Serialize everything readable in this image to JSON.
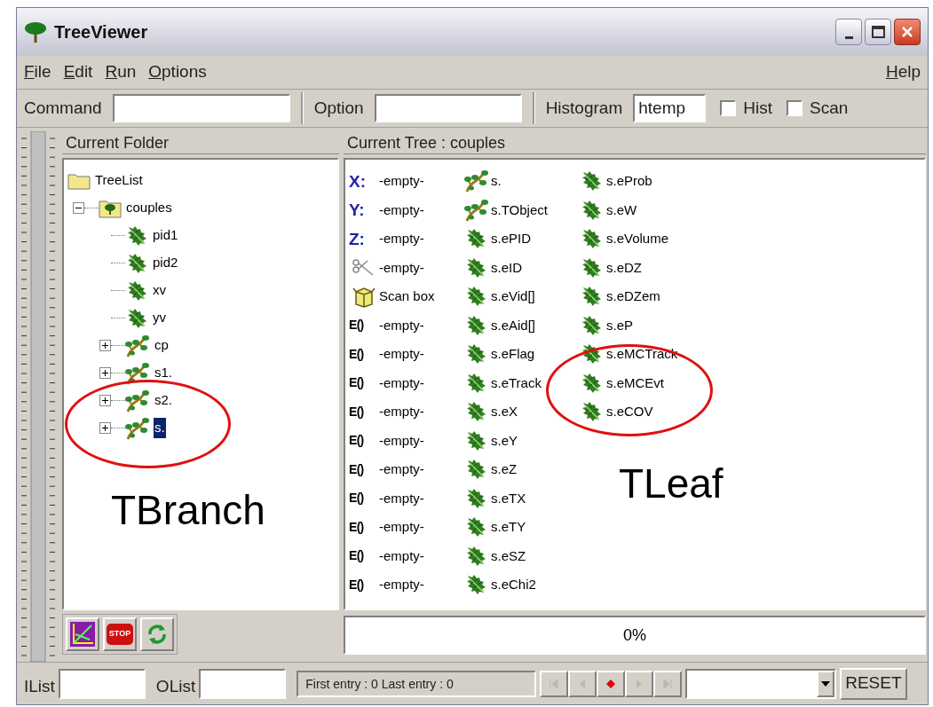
{
  "window": {
    "title": "TreeViewer"
  },
  "menu": {
    "left": [
      "File",
      "Edit",
      "Run",
      "Options"
    ],
    "right": [
      "Help"
    ]
  },
  "toolbar": {
    "command_label": "Command",
    "option_label": "Option",
    "histogram_label": "Histogram",
    "histogram_value": "htemp",
    "checkboxes": [
      {
        "label": "Hist",
        "checked": false
      },
      {
        "label": "Scan",
        "checked": false
      }
    ]
  },
  "folder": {
    "title": "Current Folder",
    "tree": [
      {
        "label": "TreeList",
        "kind": "folder",
        "selected": false,
        "children": [
          {
            "label": "couples",
            "kind": "tree",
            "expanded": true,
            "selected": false,
            "children": [
              {
                "label": "pid1",
                "kind": "leaf",
                "selected": false
              },
              {
                "label": "pid2",
                "kind": "leaf",
                "selected": false
              },
              {
                "label": "xv",
                "kind": "leaf",
                "selected": false
              },
              {
                "label": "yv",
                "kind": "leaf",
                "selected": false
              },
              {
                "label": "cp",
                "kind": "branch",
                "expanded": false,
                "selected": false
              },
              {
                "label": "s1.",
                "kind": "branch",
                "expanded": false,
                "selected": false
              },
              {
                "label": "s2.",
                "kind": "branch",
                "expanded": false,
                "selected": false
              },
              {
                "label": "s.",
                "kind": "branch",
                "expanded": false,
                "selected": true
              }
            ]
          }
        ]
      }
    ],
    "buttons": [
      {
        "kind": "draw"
      },
      {
        "kind": "stop",
        "label": "STOP"
      },
      {
        "kind": "refresh"
      }
    ]
  },
  "current_tree": {
    "title": "Current Tree : couples",
    "columns": [
      [
        {
          "kind": "axis",
          "prefix": "X:",
          "label": "-empty-"
        },
        {
          "kind": "axis",
          "prefix": "Y:",
          "label": "-empty-"
        },
        {
          "kind": "axis",
          "prefix": "Z:",
          "label": "-empty-"
        },
        {
          "kind": "cut",
          "label": "-empty-"
        },
        {
          "kind": "scan",
          "label": "Scan box"
        },
        {
          "kind": "expr",
          "prefix": "E()",
          "label": "-empty-"
        },
        {
          "kind": "expr",
          "prefix": "E()",
          "label": "-empty-"
        },
        {
          "kind": "expr",
          "prefix": "E()",
          "label": "-empty-"
        },
        {
          "kind": "expr",
          "prefix": "E()",
          "label": "-empty-"
        },
        {
          "kind": "expr",
          "prefix": "E()",
          "label": "-empty-"
        },
        {
          "kind": "expr",
          "prefix": "E()",
          "label": "-empty-"
        },
        {
          "kind": "expr",
          "prefix": "E()",
          "label": "-empty-"
        },
        {
          "kind": "expr",
          "prefix": "E()",
          "label": "-empty-"
        },
        {
          "kind": "expr",
          "prefix": "E()",
          "label": "-empty-"
        },
        {
          "kind": "expr",
          "prefix": "E()",
          "label": "-empty-"
        }
      ],
      [
        {
          "kind": "branch",
          "label": "s."
        },
        {
          "kind": "branch",
          "label": "s.TObject"
        },
        {
          "kind": "leaf",
          "label": "s.ePID"
        },
        {
          "kind": "leaf",
          "label": "s.eID"
        },
        {
          "kind": "leaf",
          "label": "s.eVid[]"
        },
        {
          "kind": "leaf",
          "label": "s.eAid[]"
        },
        {
          "kind": "leaf",
          "label": "s.eFlag"
        },
        {
          "kind": "leaf",
          "label": "s.eTrack"
        },
        {
          "kind": "leaf",
          "label": "s.eX"
        },
        {
          "kind": "leaf",
          "label": "s.eY"
        },
        {
          "kind": "leaf",
          "label": "s.eZ"
        },
        {
          "kind": "leaf",
          "label": "s.eTX"
        },
        {
          "kind": "leaf",
          "label": "s.eTY"
        },
        {
          "kind": "leaf",
          "label": "s.eSZ"
        },
        {
          "kind": "leaf",
          "label": "s.eChi2"
        }
      ],
      [
        {
          "kind": "leaf",
          "label": "s.eProb"
        },
        {
          "kind": "leaf",
          "label": "s.eW"
        },
        {
          "kind": "leaf",
          "label": "s.eVolume"
        },
        {
          "kind": "leaf",
          "label": "s.eDZ"
        },
        {
          "kind": "leaf",
          "label": "s.eDZem"
        },
        {
          "kind": "leaf",
          "label": "s.eP"
        },
        {
          "kind": "leaf",
          "label": "s.eMCTrack"
        },
        {
          "kind": "leaf",
          "label": "s.eMCEvt"
        },
        {
          "kind": "leaf",
          "label": "s.eCOV"
        }
      ]
    ],
    "progress": {
      "reading": "0%"
    }
  },
  "bottom": {
    "ilist_label": "IList",
    "olist_label": "OList",
    "status": "First entry : 0 Last entry : 0",
    "nav": [
      {
        "kind": "first",
        "disabled": true
      },
      {
        "kind": "prev",
        "disabled": true
      },
      {
        "kind": "record",
        "disabled": false
      },
      {
        "kind": "next",
        "disabled": true
      },
      {
        "kind": "last",
        "disabled": true
      }
    ],
    "reset": "RESET"
  },
  "annotations": [
    {
      "kind": "circle"
    },
    {
      "kind": "circle"
    },
    {
      "kind": "label",
      "text": "TBranch"
    },
    {
      "kind": "label",
      "text": "TLeaf"
    }
  ]
}
